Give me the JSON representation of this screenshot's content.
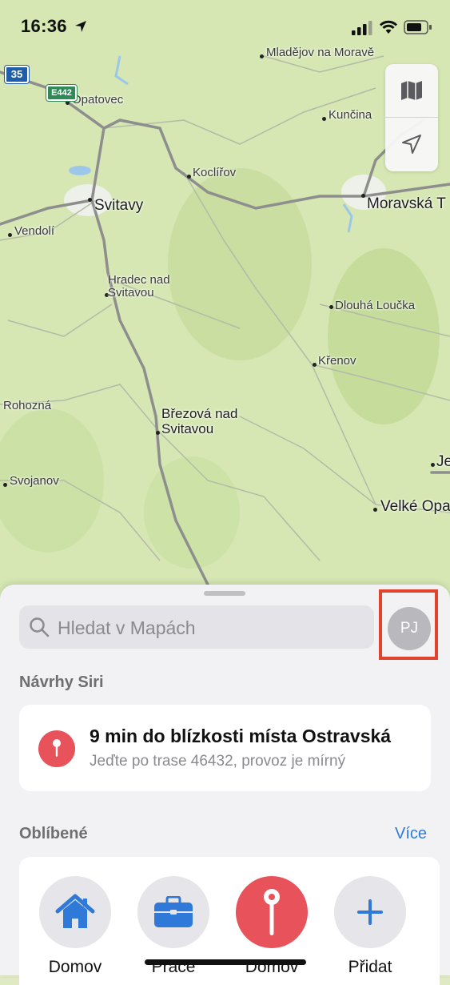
{
  "status_bar": {
    "time": "16:36"
  },
  "map": {
    "places": [
      {
        "name": "Mladějov na Moravě"
      },
      {
        "name": "Opatovec"
      },
      {
        "name": "Kunčina"
      },
      {
        "name": "Koclířov"
      },
      {
        "name": "Svitavy"
      },
      {
        "name": "Moravská T"
      },
      {
        "name": "Vendolí"
      },
      {
        "name": "Hradec nad Svitavou"
      },
      {
        "name": "Dlouhá Loučka"
      },
      {
        "name": "Křenov"
      },
      {
        "name": "Rohozná"
      },
      {
        "name": "Březová nad Svitavou"
      },
      {
        "name": "Je"
      },
      {
        "name": "Svojanov"
      },
      {
        "name": "Velké Opa"
      }
    ],
    "road_shields": [
      "35",
      "E442"
    ]
  },
  "search": {
    "placeholder": "Hledat v Mapách"
  },
  "profile": {
    "initials": "PJ"
  },
  "siri": {
    "heading": "Návrhy Siri",
    "card_title": "9 min do blízkosti místa Ostravská",
    "card_subtitle": "Jeďte po trase 46432, provoz je mírný"
  },
  "favorites": {
    "heading": "Oblíbené",
    "more_label": "Více",
    "items": [
      {
        "label": "Domov",
        "icon": "home-icon"
      },
      {
        "label": "Práce",
        "icon": "briefcase-icon"
      },
      {
        "label": "Domov",
        "icon": "pin-icon"
      },
      {
        "label": "Přidat",
        "icon": "plus-icon"
      }
    ]
  },
  "colors": {
    "accent": "#2f7ad9",
    "pin_red": "#e8525a",
    "highlight_box": "#e0442f"
  }
}
